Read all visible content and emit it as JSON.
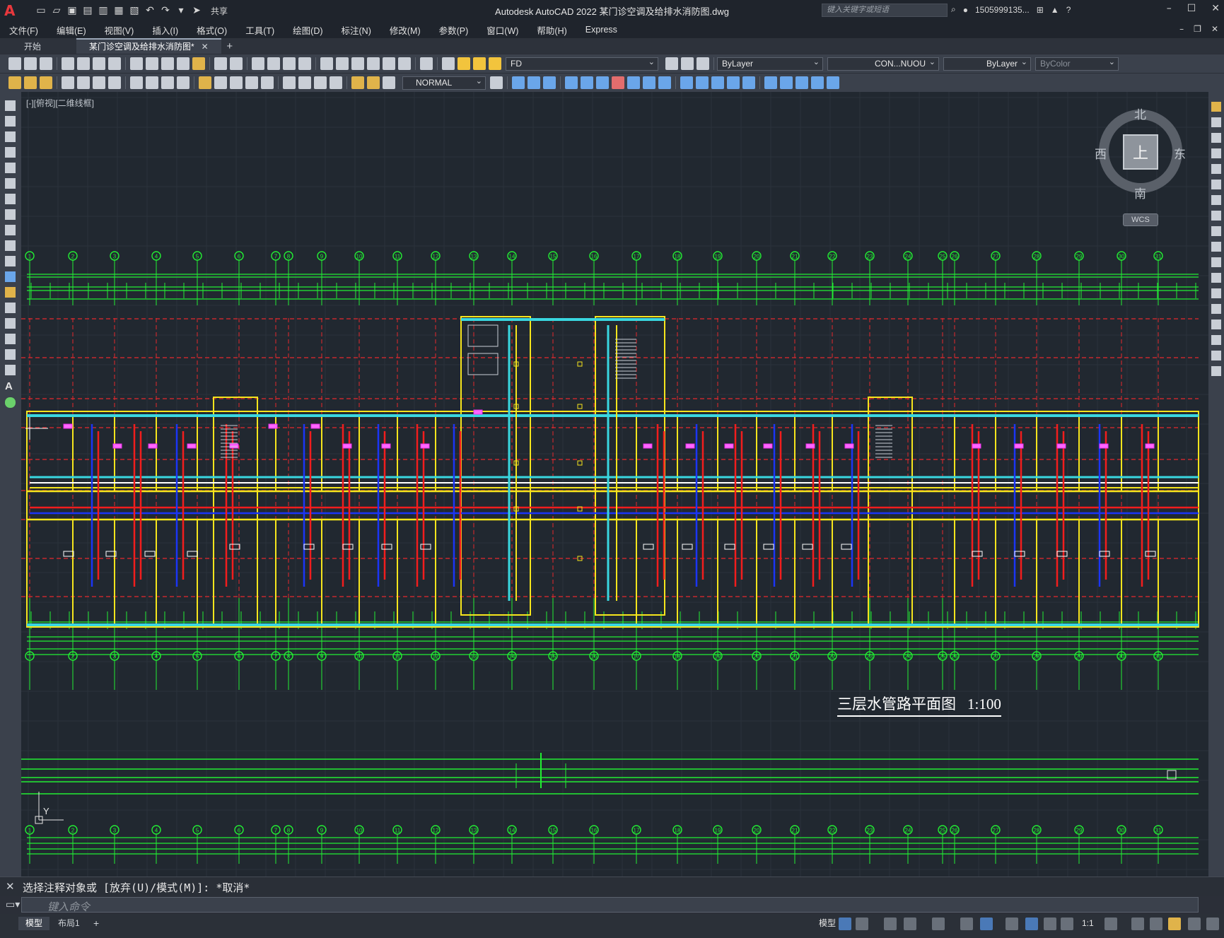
{
  "app": {
    "title": "Autodesk AutoCAD 2022    某门诊空调及给排水消防图.dwg",
    "search_placeholder": "键入关键字或短语",
    "user": "1505999135...",
    "share_label": "共享",
    "logo_letter": "A"
  },
  "menu": [
    "文件(F)",
    "编辑(E)",
    "视图(V)",
    "插入(I)",
    "格式(O)",
    "工具(T)",
    "绘图(D)",
    "标注(N)",
    "修改(M)",
    "参数(P)",
    "窗口(W)",
    "帮助(H)",
    "Express"
  ],
  "tabs": [
    {
      "label": "开始",
      "active": false
    },
    {
      "label": "某门诊空调及给排水消防图*",
      "active": true
    }
  ],
  "properties": {
    "layer": "FD",
    "color": "ByLayer",
    "linetype": "CON...NUOU",
    "lineweight": "ByLayer",
    "plotstyle": "ByColor",
    "dimstyle": "NORMAL"
  },
  "viewport": {
    "label": "[-][俯视][二维线框]",
    "compass": {
      "north": "北",
      "south": "南",
      "east": "东",
      "west": "西",
      "top": "上"
    },
    "wcs": "WCS"
  },
  "drawing": {
    "title": "三层水管路平面图",
    "scale": "1:100",
    "grid_numbers": [
      "1",
      "2",
      "3",
      "4",
      "5",
      "6",
      "7",
      "8",
      "9",
      "10",
      "11",
      "12",
      "13",
      "14",
      "15",
      "16",
      "17",
      "18",
      "19",
      "20",
      "21",
      "22",
      "23",
      "24",
      "25",
      "26",
      "27",
      "28",
      "29",
      "30",
      "31"
    ]
  },
  "command": {
    "history": "选择注释对象或 [放弃(U)/模式(M)]: *取消*",
    "placeholder": "键入命令"
  },
  "layout_tabs": [
    "模型",
    "布局1"
  ],
  "status": {
    "model_label": "模型",
    "scale": "1:1"
  },
  "colors": {
    "grid_green": "#22ee33",
    "wall_yellow": "#f6e51c",
    "pipe_red": "#f21d1d",
    "pipe_cyan": "#39d7e0",
    "pipe_blue": "#1b35f5",
    "axis_red": "#e5282d",
    "label_magenta": "#e830e8"
  }
}
